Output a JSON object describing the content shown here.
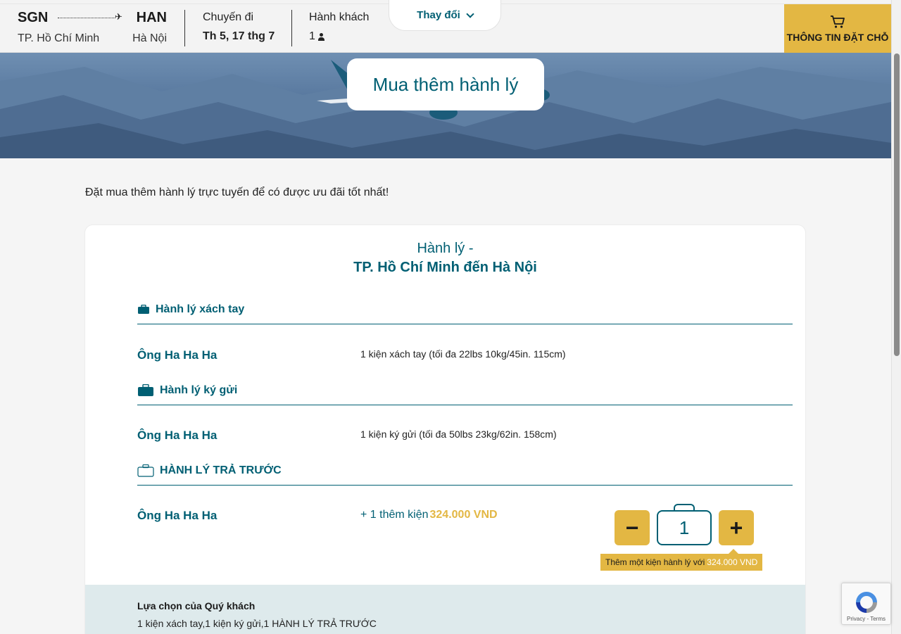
{
  "header": {
    "from_code": "SGN",
    "to_code": "HAN",
    "from_city": "TP. Hồ Chí Minh",
    "to_city": "Hà Nội",
    "trip_label": "Chuyến đi",
    "trip_date": "Th 5, 17 thg 7",
    "passenger_label": "Hành khách",
    "passenger_count": "1",
    "change_label": "Thay đổi",
    "cart_label": "THÔNG TIN ĐẶT CHỖ"
  },
  "hero": {
    "title": "Mua thêm hành lý"
  },
  "intro": "Đặt mua thêm hành lý trực tuyến để có được ưu đãi tốt nhất!",
  "card": {
    "subtitle": "Hành lý -",
    "title": "TP. Hồ Chí Minh đến Hà Nội",
    "sections": [
      {
        "title": "Hành lý xách tay",
        "passenger": "Ông Ha Ha Ha",
        "description": "1 kiện xách tay (tối đa 22lbs 10kg/45in. 115cm)"
      },
      {
        "title": "Hành lý ký gửi",
        "passenger": "Ông Ha Ha Ha",
        "description": "1 kiện ký gửi (tối đa 50lbs 23kg/62in. 158cm)"
      },
      {
        "title": "HÀNH LÝ TRẢ TRƯỚC",
        "passenger": "Ông Ha Ha Ha",
        "extra_label": "+ 1 thêm kiện",
        "extra_price": "324.000 VND"
      }
    ],
    "stepper": {
      "minus": "−",
      "value": "1",
      "plus": "+"
    },
    "tooltip": {
      "text": "Thêm một kiện hành lý với",
      "price": "324.000 VND"
    },
    "choice": {
      "title": "Lựa chọn của Quý khách",
      "value": "1 kiện xách tay,1 kiện ký gửi,1 HÀNH LÝ TRẢ TRƯỚC"
    }
  },
  "recaptcha": {
    "terms": "Privacy - Terms"
  },
  "colors": {
    "primary": "#005f73",
    "accent": "#e3b743",
    "choice_bg": "#deeaec"
  },
  "icons": [
    "plane-icon",
    "person-icon",
    "chevron-down-icon",
    "cart-icon",
    "carry-on-bag-icon",
    "checked-bag-icon",
    "prepaid-bag-icon",
    "recaptcha-icon"
  ]
}
